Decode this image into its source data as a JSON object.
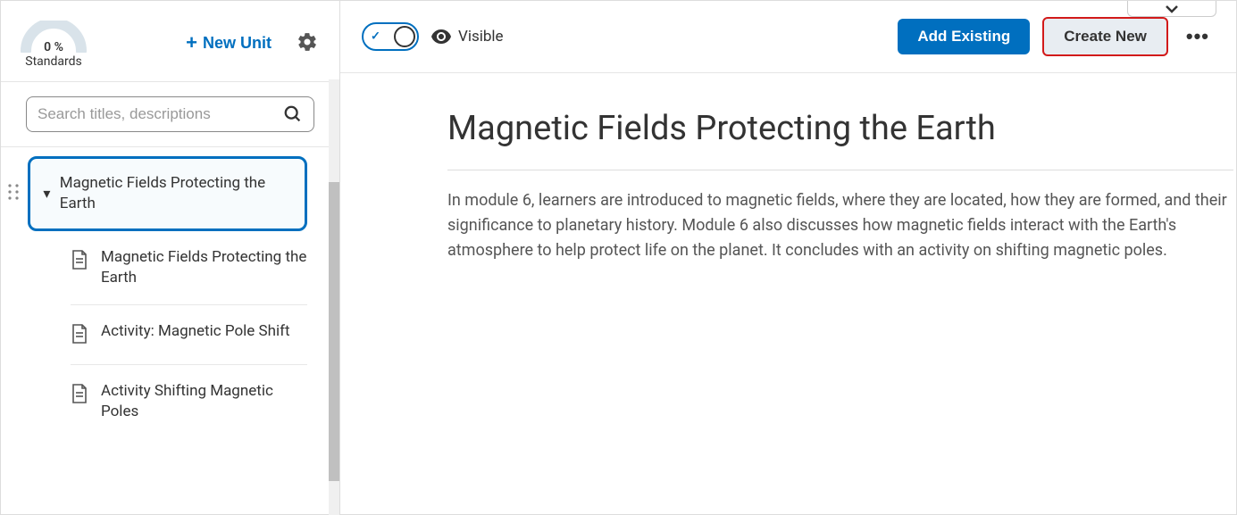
{
  "sidebar": {
    "standards_percent": "0 %",
    "standards_label": "Standards",
    "new_unit_label": "New Unit",
    "search_placeholder": "Search titles, descriptions"
  },
  "tree": {
    "unit_title": "Magnetic Fields Protecting the Earth",
    "children": [
      {
        "title": "Magnetic Fields Protecting the Earth"
      },
      {
        "title": "Activity: Magnetic Pole Shift"
      },
      {
        "title": "Activity Shifting Magnetic Poles"
      }
    ]
  },
  "toolbar": {
    "visible_label": "Visible",
    "add_existing_label": "Add Existing",
    "create_new_label": "Create New"
  },
  "content": {
    "title": "Magnetic Fields Protecting the Earth",
    "description": "In module 6, learners are introduced to magnetic fields, where they are located, how they are formed, and their significance to planetary history. Module 6 also discusses how magnetic fields interact with the Earth's atmosphere to help protect life on the planet. It concludes with an activity on shifting magnetic poles."
  }
}
